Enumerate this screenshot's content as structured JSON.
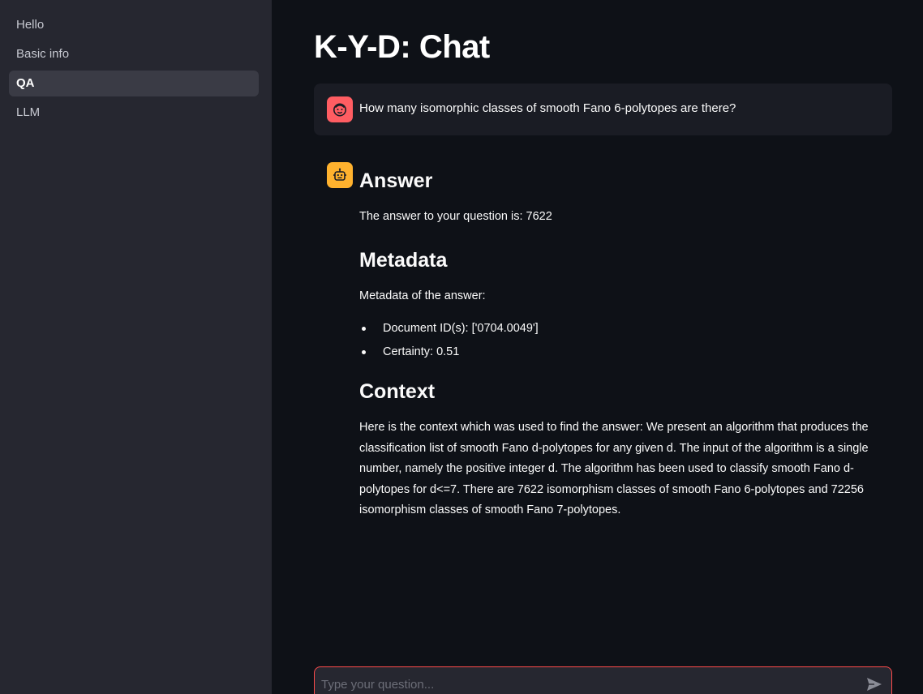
{
  "sidebar": {
    "items": [
      {
        "label": "Hello"
      },
      {
        "label": "Basic info"
      },
      {
        "label": "QA"
      },
      {
        "label": "LLM"
      }
    ],
    "active_index": 2
  },
  "page": {
    "title": "K-Y-D: Chat"
  },
  "user_message": {
    "avatar_icon": "smile-face-icon",
    "text": "How many isomorphic classes of smooth Fano 6-polytopes are there?"
  },
  "assistant_message": {
    "avatar_icon": "robot-icon",
    "answer_heading": "Answer",
    "answer_text": "The answer to your question is: 7622",
    "metadata_heading": "Metadata",
    "metadata_intro": "Metadata of the answer:",
    "metadata_items": [
      "Document ID(s): ['0704.0049']",
      "Certainty: 0.51"
    ],
    "context_heading": "Context",
    "context_text": "Here is the context which was used to find the answer: We present an algorithm that produces the classification list of smooth Fano d-polytopes for any given d. The input of the algorithm is a single number, namely the positive integer d. The algorithm has been used to classify smooth Fano d-polytopes for d<=7. There are 7622 isomorphism classes of smooth Fano 6-polytopes and 72256 isomorphism classes of smooth Fano 7-polytopes."
  },
  "chat_input": {
    "placeholder": "Type your question...",
    "value": "",
    "send_icon": "send-icon"
  },
  "colors": {
    "background": "#0e1117",
    "sidebar": "#262730",
    "accent": "#ff4b4b",
    "user_avatar": "#ff5d62",
    "bot_avatar": "#ffb22e"
  }
}
